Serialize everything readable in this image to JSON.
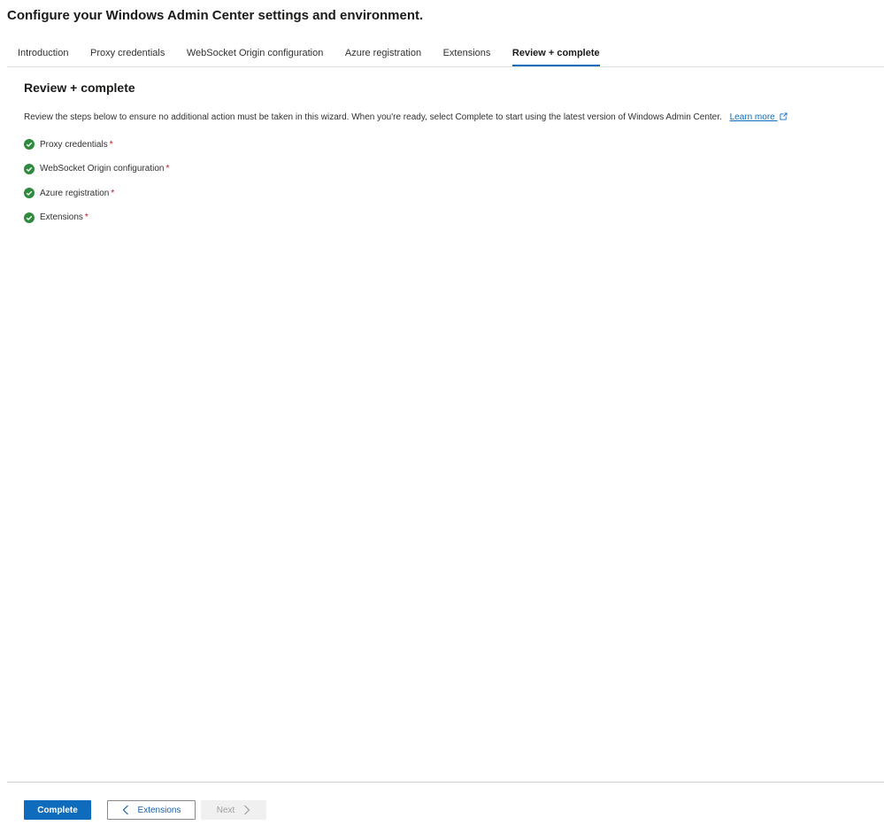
{
  "page": {
    "title": "Configure your Windows Admin Center settings and environment."
  },
  "tabs": [
    {
      "label": "Introduction",
      "active": false
    },
    {
      "label": "Proxy credentials",
      "active": false
    },
    {
      "label": "WebSocket Origin configuration",
      "active": false
    },
    {
      "label": "Azure registration",
      "active": false
    },
    {
      "label": "Extensions",
      "active": false
    },
    {
      "label": "Review + complete",
      "active": true
    }
  ],
  "content": {
    "section_title": "Review + complete",
    "description": "Review the steps below to ensure no additional action must be taken in this wizard. When you're ready, select Complete to start using the latest version of Windows Admin Center.",
    "learn_more": "Learn more",
    "required_marker": "*",
    "steps": [
      {
        "label": "Proxy credentials",
        "status": "complete"
      },
      {
        "label": "WebSocket Origin configuration",
        "status": "complete"
      },
      {
        "label": "Azure registration",
        "status": "complete"
      },
      {
        "label": "Extensions",
        "status": "complete"
      }
    ]
  },
  "footer": {
    "complete_label": "Complete",
    "back_label": "Extensions",
    "next_label": "Next"
  },
  "colors": {
    "accent": "#0f6cbd",
    "success": "#2e8b3e",
    "required": "#c50f1f"
  },
  "icons": {
    "step_status": "check-circle-icon",
    "external_link": "external-link-icon",
    "back": "chevron-left-icon",
    "next": "chevron-right-icon"
  }
}
